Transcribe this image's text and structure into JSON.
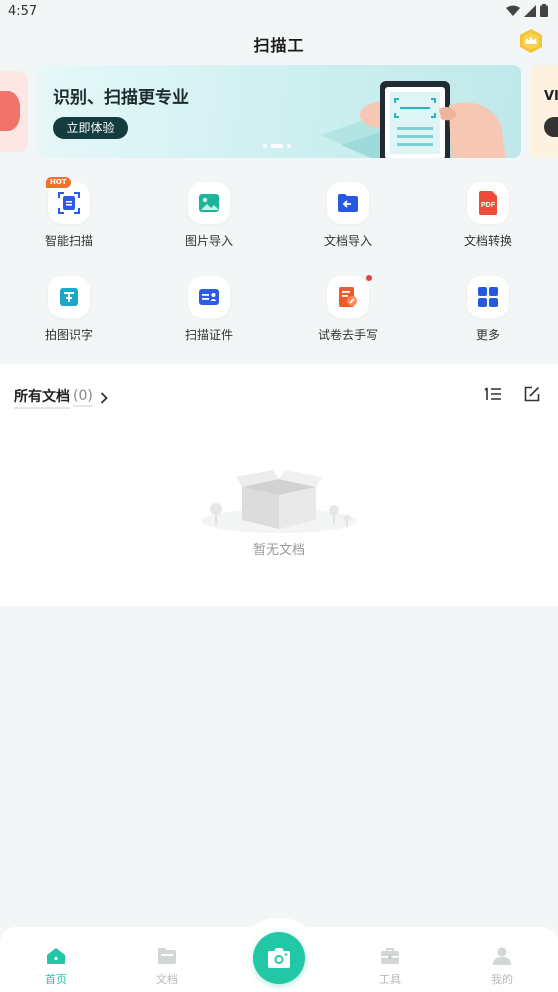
{
  "status_bar": {
    "time": "4:57"
  },
  "header": {
    "title": "扫描工"
  },
  "banner": {
    "title": "识别、扫描更专业",
    "button": "立即体验",
    "next_peek_text": "VI"
  },
  "tools": [
    {
      "label": "智能扫描",
      "badge": "HOT"
    },
    {
      "label": "图片导入"
    },
    {
      "label": "文档导入"
    },
    {
      "label": "文档转换",
      "icon_text": "PDF"
    },
    {
      "label": "拍图识字"
    },
    {
      "label": "扫描证件"
    },
    {
      "label": "试卷去手写"
    },
    {
      "label": "更多"
    }
  ],
  "documents": {
    "title": "所有文档",
    "count": "(0)",
    "empty_text": "暂无文档"
  },
  "tabbar": {
    "tabs": [
      {
        "label": "首页"
      },
      {
        "label": "文档"
      },
      {
        "label": "工具"
      },
      {
        "label": "我的"
      }
    ]
  },
  "colors": {
    "accent": "#22c7a5",
    "banner_button": "#143b40",
    "hot": "#f2702e"
  }
}
